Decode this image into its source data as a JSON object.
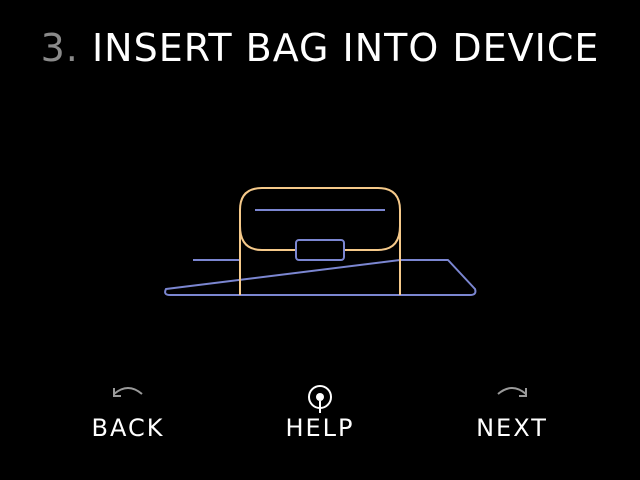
{
  "header": {
    "step_number": "3.",
    "step_text": "INSERT BAG INTO DEVICE"
  },
  "colors": {
    "background": "#000000",
    "title": "#ffffff",
    "step_number": "#8a8a8a",
    "bag_outline": "#f5c98a",
    "device_outline": "#7b86d1"
  },
  "nav": {
    "back": {
      "label": "BACK",
      "icon": "back-arrow-icon"
    },
    "help": {
      "label": "HELP",
      "icon": "help-pin-icon"
    },
    "next": {
      "label": "NEXT",
      "icon": "next-arrow-icon"
    }
  }
}
